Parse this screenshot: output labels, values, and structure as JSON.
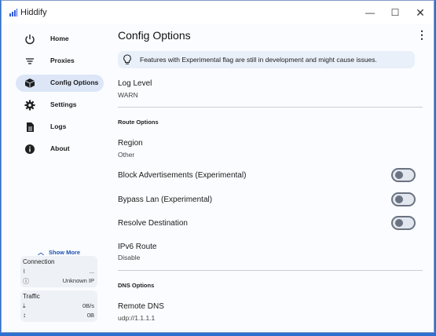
{
  "window": {
    "title": "Hiddify",
    "minimize": "—",
    "maximize": "☐",
    "close": "✕"
  },
  "sidebar": {
    "items": [
      {
        "label": "Home",
        "icon": "power-icon"
      },
      {
        "label": "Proxies",
        "icon": "filter-icon"
      },
      {
        "label": "Config Options",
        "icon": "box-icon",
        "active": true
      },
      {
        "label": "Settings",
        "icon": "gear-icon"
      },
      {
        "label": "Logs",
        "icon": "document-icon"
      },
      {
        "label": "About",
        "icon": "info-icon"
      }
    ],
    "show_more": "Show More",
    "connection": {
      "title": "Connection",
      "ping_value": "...",
      "ip": "Unknown IP"
    },
    "traffic": {
      "title": "Traffic",
      "speed": "0B/s",
      "total": "0B"
    }
  },
  "main": {
    "title": "Config Options",
    "banner": "Features with Experimental flag are still in development and might cause issues.",
    "log_level": {
      "label": "Log Level",
      "value": "WARN"
    },
    "route_section": "Route Options",
    "region": {
      "label": "Region",
      "value": "Other"
    },
    "toggles": [
      {
        "label": "Block Advertisements (Experimental)",
        "on": false
      },
      {
        "label": "Bypass Lan (Experimental)",
        "on": false
      },
      {
        "label": "Resolve Destination",
        "on": false
      }
    ],
    "ipv6": {
      "label": "IPv6 Route",
      "value": "Disable"
    },
    "dns_section": "DNS Options",
    "remote_dns": {
      "label": "Remote DNS",
      "value": "udp://1.1.1.1"
    }
  }
}
